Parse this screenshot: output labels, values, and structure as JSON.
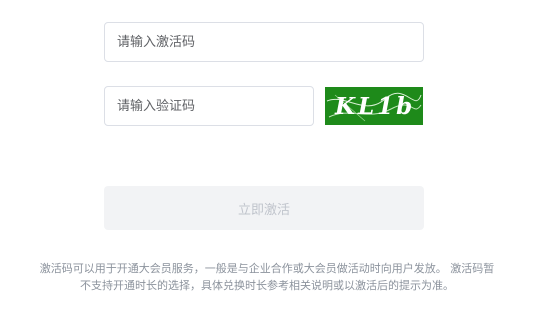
{
  "form": {
    "activation_code_placeholder": "请输入激活码",
    "captcha_placeholder": "请输入验证码",
    "captcha_text": "KL1b",
    "submit_label": "立即激活"
  },
  "note": {
    "line1": "激活码可以用于开通大会员服务，一般是与企业合作或大会员做活动时向用户发放。 激活码暂",
    "line2": "不支持开通时长的选择，具体兑换时长参考相关说明或以激活后的提示为准。"
  },
  "colors": {
    "captcha_bg": "#1e8a1a",
    "button_bg": "#f2f3f5",
    "button_text": "#c0c4cc"
  }
}
